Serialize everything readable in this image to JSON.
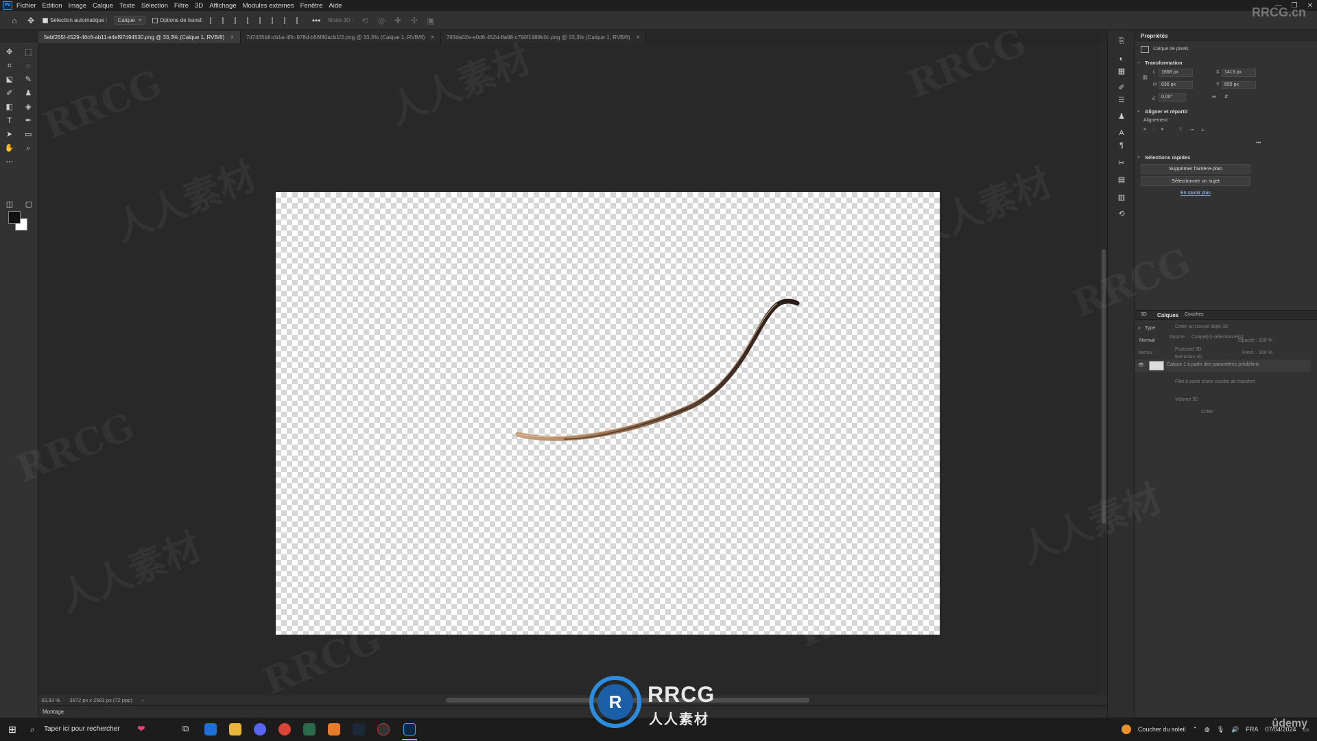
{
  "menubar": {
    "app_icon": "Ps",
    "items": [
      "Fichier",
      "Edition",
      "Image",
      "Calque",
      "Texte",
      "Sélection",
      "Filtre",
      "3D",
      "Affichage",
      "Modules externes",
      "Fenêtre",
      "Aide"
    ]
  },
  "options": {
    "auto_select_label": "Sélection automatique :",
    "auto_select_value": "Calque",
    "transform_label": "Options de transf.",
    "mode3d_label": "Mode 3D :",
    "more": "•••"
  },
  "tabs": [
    {
      "label": "5ebf265f-4529-46c6-ab11-e4ef97d94530.png @ 33,3% (Calque 1, RVB/8)",
      "active": true
    },
    {
      "label": "7d7435b8-cb1a-4ffc-978d-b56f80acb1f2.png @ 33,3% (Calque 1, RVB/8)",
      "active": false
    },
    {
      "label": "793da02e-e0d6-452d-8a98-c790f1989b0c.png @ 33,3% (Calque 1, RVB/8)",
      "active": false
    }
  ],
  "status": {
    "zoom": "33,33 %",
    "doc_size": "3872 px x 2581 px (72 ppp)",
    "arrow": "›"
  },
  "timeline": {
    "label": "Montage"
  },
  "properties": {
    "tab": "Propriétés",
    "layer_kind": "Calque de pixels",
    "transform_title": "Transformation",
    "w_label": "L",
    "w_value": "1668 px",
    "x_label": "X",
    "x_value": "1413 px",
    "h_label": "H",
    "h_value": "836 px",
    "y_label": "Y",
    "y_value": "655 px",
    "angle_value": "0,00°",
    "align_title": "Aligner et répartir",
    "align_label": "Alignement :",
    "more": "•••",
    "quick_title": "Sélections rapides",
    "remove_bg": "Supprimer l'arrière-plan",
    "select_subject": "Sélectionner un sujet",
    "learn_more": "En savoir plus"
  },
  "layers": {
    "tabs": [
      "3D",
      "Calques",
      "Couches"
    ],
    "filter_label": "Type",
    "blend": "Normal",
    "opacity_label": "Opacité :",
    "opacity_value": "100 %",
    "lock_label": "Verrou :",
    "fill_label": "Fond :",
    "fill_value": "100 %",
    "popup_title": "Créer un nouvel objet 3D",
    "popup_source": "Source :",
    "popup_source_value": "Calque(s) sélectionné(s)",
    "popup_3d_postcard": "Postcard 3D",
    "popup_3d_extrusion": "Extrusion 3D",
    "layer_row": "Calque 1 à partir des paramètres prédéfinis",
    "popup_mesh_curve": "Filet à partir d'une courbe de transfert",
    "popup_volume": "Volume 3D",
    "popup_create": "Créer"
  },
  "taskbar": {
    "search": "Taper ici pour rechercher",
    "weather": "Coucher du soleil",
    "lang": "FRA",
    "date": "07/04/2024"
  },
  "watermark": {
    "brand": "RRCG",
    "sub": "人人素材",
    "corner": "RRCG.cn",
    "udemy": "ûdemy"
  },
  "colors": {
    "bg": "#282828",
    "panel": "#323232",
    "stroke_dark": "#3a2a22",
    "stroke_light": "#b88e68"
  }
}
